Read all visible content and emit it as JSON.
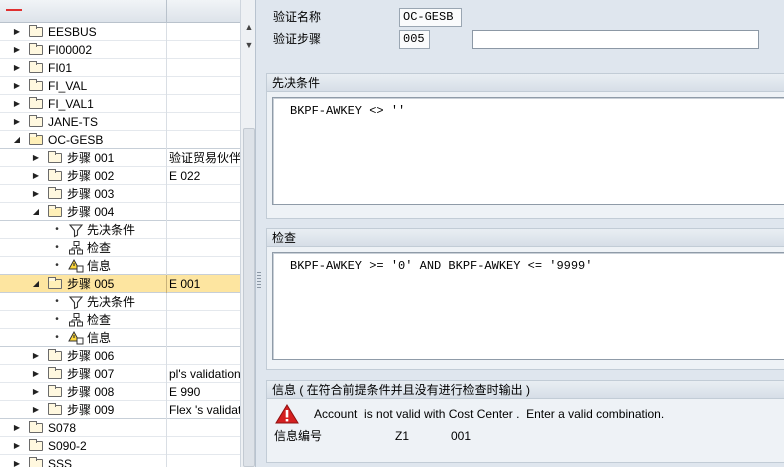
{
  "tree": {
    "rows": [
      {
        "label": "EESBUS",
        "desc": ""
      },
      {
        "label": "FI00002",
        "desc": ""
      },
      {
        "label": "FI01",
        "desc": ""
      },
      {
        "label": "FI_VAL",
        "desc": ""
      },
      {
        "label": "FI_VAL1",
        "desc": ""
      },
      {
        "label": "JANE-TS",
        "desc": ""
      },
      {
        "label": "OC-GESB",
        "desc": ""
      },
      {
        "label": "步骤 001",
        "desc": "验证贸易伙伴"
      },
      {
        "label": "步骤 002",
        "desc": "E 022"
      },
      {
        "label": "步骤 003",
        "desc": ""
      },
      {
        "label": "步骤 004",
        "desc": ""
      },
      {
        "label": "先决条件",
        "desc": ""
      },
      {
        "label": "检查",
        "desc": ""
      },
      {
        "label": "信息",
        "desc": ""
      },
      {
        "label": "步骤 005",
        "desc": "E 001"
      },
      {
        "label": "先决条件",
        "desc": ""
      },
      {
        "label": "检查",
        "desc": ""
      },
      {
        "label": "信息",
        "desc": ""
      },
      {
        "label": "步骤 006",
        "desc": ""
      },
      {
        "label": "步骤 007",
        "desc": "pl's validation"
      },
      {
        "label": "步骤 008",
        "desc": "E 990"
      },
      {
        "label": "步骤 009",
        "desc": "Flex 's validat"
      },
      {
        "label": "S078",
        "desc": ""
      },
      {
        "label": "S090-2",
        "desc": ""
      },
      {
        "label": "SSS",
        "desc": ""
      }
    ]
  },
  "header": {
    "validation_name_label": "验证名称",
    "validation_name_value": "OC-GESB",
    "validation_step_label": "验证步骤",
    "validation_step_value": "005",
    "step_text_value": ""
  },
  "prerequisite": {
    "title": "先决条件",
    "code": "BKPF-AWKEY <> ''"
  },
  "check": {
    "title": "检查",
    "code": "BKPF-AWKEY >= '0' AND BKPF-AWKEY <= '9999'"
  },
  "message": {
    "title": "信息 ( 在符合前提条件并且没有进行检查时输出 )",
    "text": "Account  is not valid with Cost Center .  Enter a valid combination.",
    "number_label": "信息编号",
    "msg_class": "Z1",
    "msg_number": "001",
    "icon": "warning-icon"
  },
  "colors": {
    "selected_row": "#fde5a0",
    "warning": "#d42020",
    "panel": "#eef2f6"
  }
}
